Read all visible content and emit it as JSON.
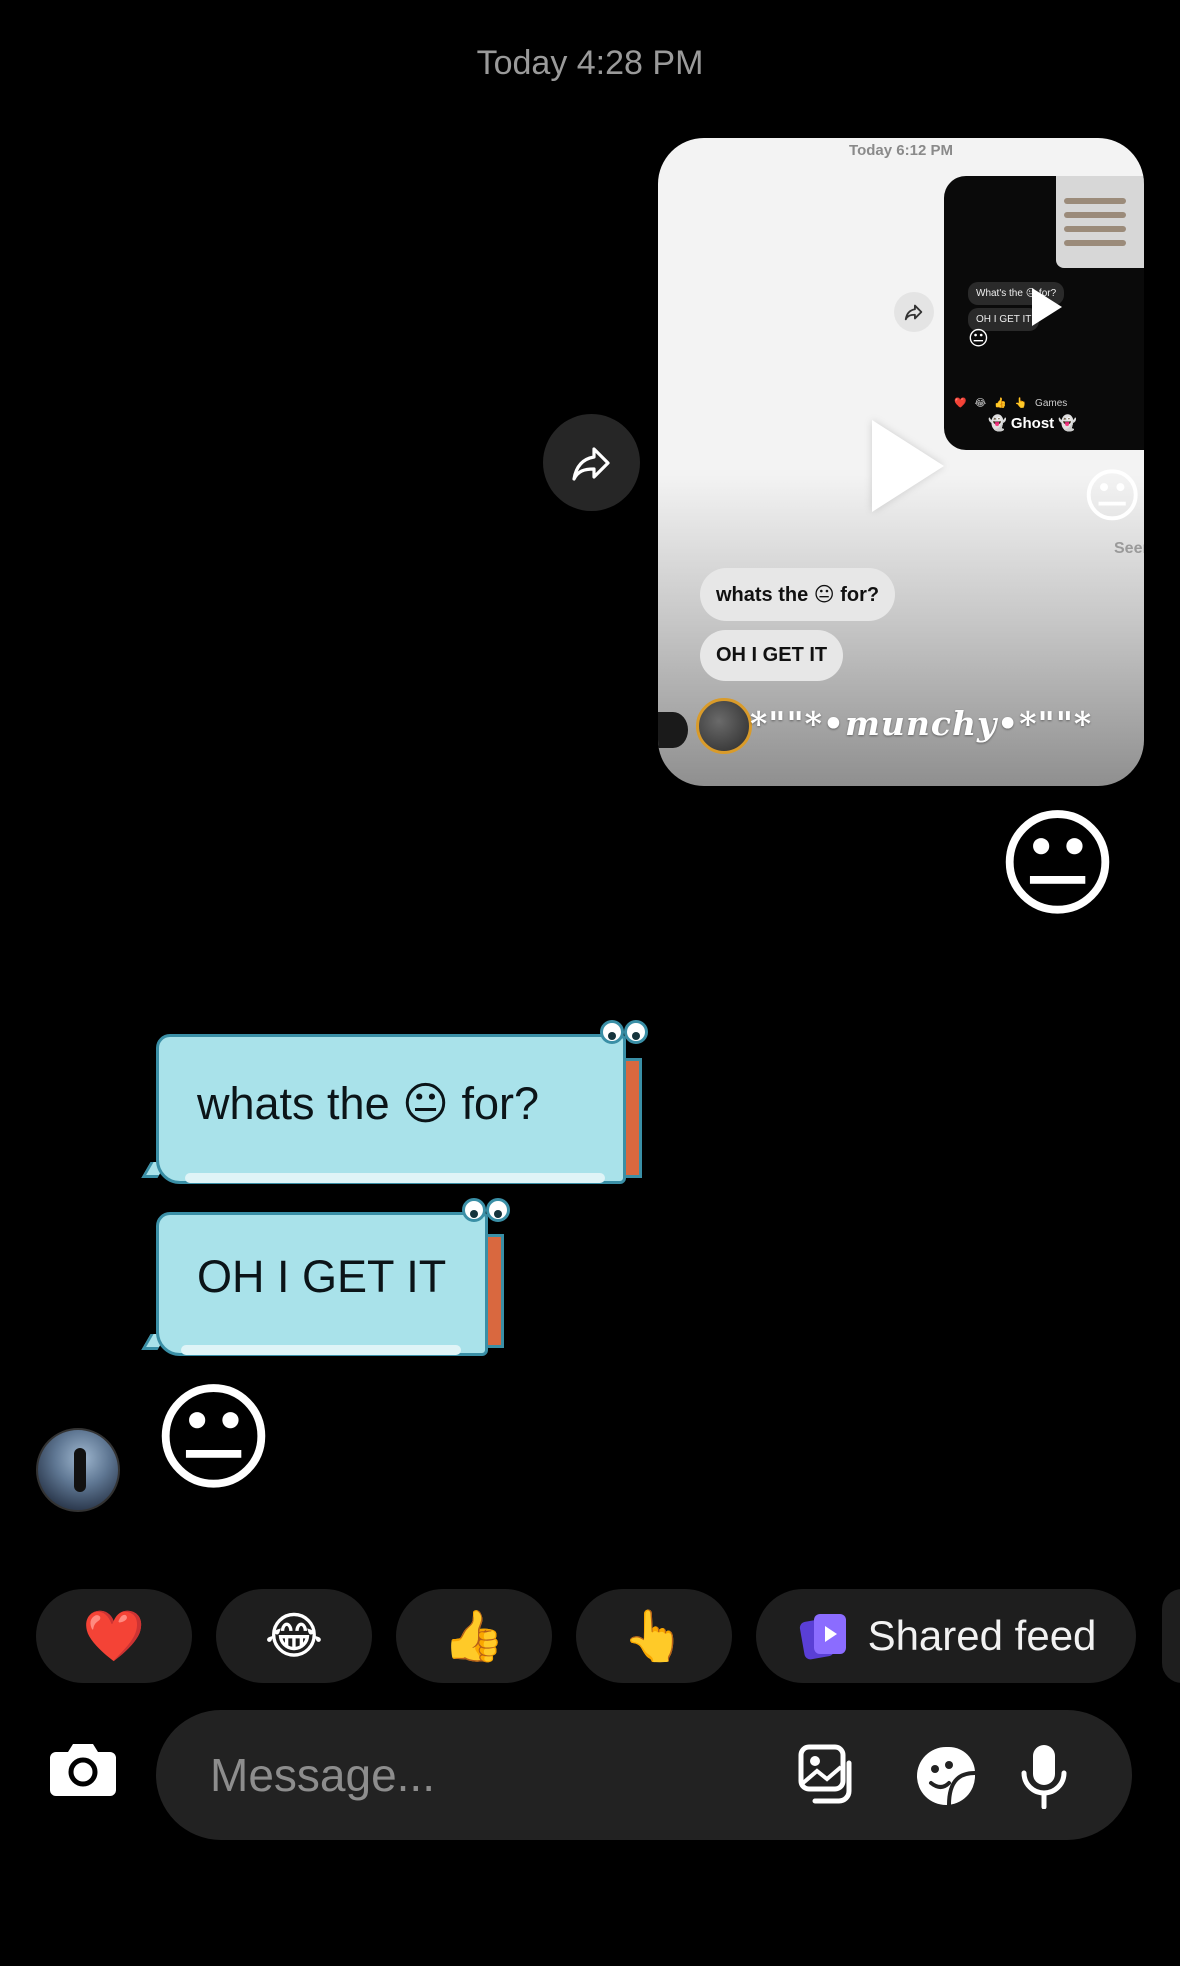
{
  "header": {
    "timestamp": "Today 4:28 PM"
  },
  "shared_video": {
    "timestamp": "Today 6:12 PM",
    "inner_bubbles": [
      "What's the 😐 for?",
      "OH I GET IT"
    ],
    "inner_name": "👻 Ghost 👻",
    "inner_row": [
      "❤️",
      "😂",
      "👍",
      "👆",
      "Games"
    ],
    "seen_label": "Seen",
    "bubbles": [
      "whats the 😐 for?",
      "OH I GET IT"
    ],
    "sender_name": "*\"\"*•munchy•*\"\"*",
    "emoji": "😐"
  },
  "messages": {
    "sent_emoji": "😐",
    "received": [
      "whats the 😐 for?",
      "OH I GET IT"
    ],
    "received_emoji": "😐"
  },
  "quick_reactions": {
    "emojis": [
      "❤️",
      "😂",
      "👍",
      "👆"
    ],
    "shared_feed_label": "Shared feed"
  },
  "composer": {
    "placeholder": "Message..."
  },
  "colors": {
    "background": "#000000",
    "chip": "#1e1e1e",
    "composer": "#222222",
    "croc_body": "#a9e2ea",
    "croc_outline": "#3a8fa6",
    "feed_icon": "#7b5cf5"
  }
}
